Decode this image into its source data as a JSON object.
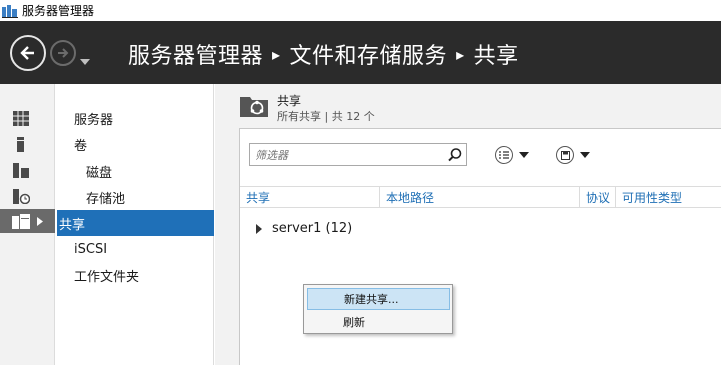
{
  "window": {
    "title": "服务器管理器"
  },
  "header": {
    "crumbs": [
      "服务器管理器",
      "文件和存储服务",
      "共享"
    ],
    "separator": "▸"
  },
  "nav": {
    "items": [
      {
        "label": "服务器",
        "indent": false,
        "active": false
      },
      {
        "label": "卷",
        "indent": false,
        "active": false
      },
      {
        "label": "磁盘",
        "indent": true,
        "active": false
      },
      {
        "label": "存储池",
        "indent": true,
        "active": false
      },
      {
        "label": "共享",
        "indent": false,
        "active": true
      },
      {
        "label": "iSCSI",
        "indent": false,
        "active": false
      },
      {
        "label": "工作文件夹",
        "indent": false,
        "active": false
      }
    ]
  },
  "content": {
    "title": "共享",
    "subtitle": "所有共享 | 共 12 个",
    "filter": {
      "placeholder": "筛选器"
    },
    "columns": [
      "共享",
      "本地路径",
      "协议",
      "可用性类型"
    ],
    "group": {
      "label": "server1 (12)"
    }
  },
  "context_menu": {
    "items": [
      {
        "label": "新建共享...",
        "highlighted": true
      },
      {
        "label": "刷新",
        "highlighted": false
      }
    ]
  },
  "colors": {
    "accent": "#1f70b8",
    "header_bg": "#2b2b2b",
    "link": "#1f6fb5"
  }
}
